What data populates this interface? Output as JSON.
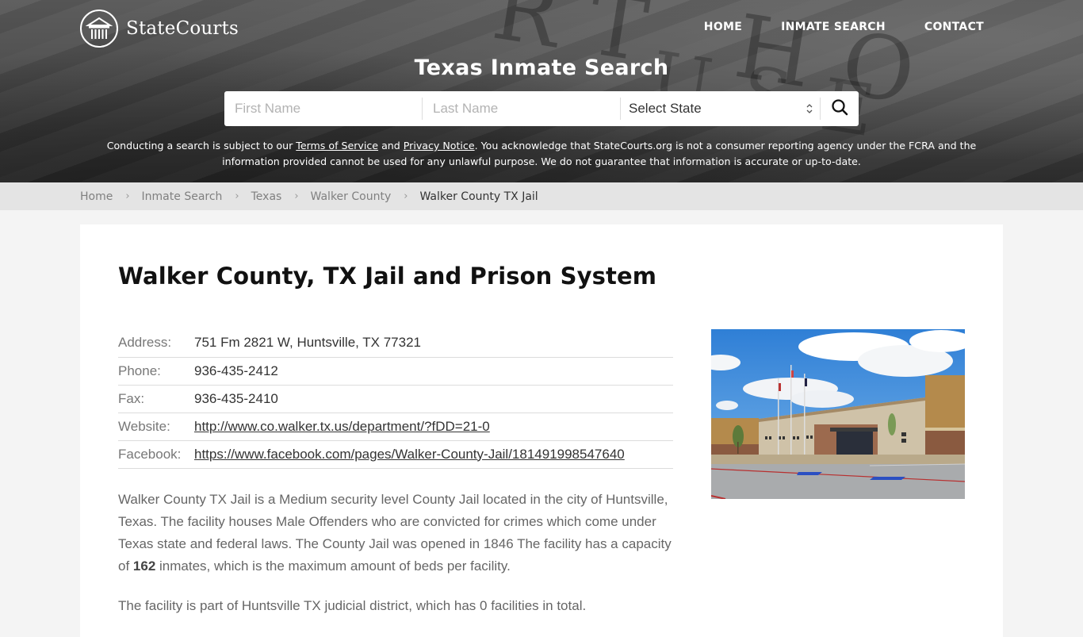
{
  "brand": {
    "name": "StateCourts"
  },
  "nav": {
    "items": [
      {
        "label": "HOME"
      },
      {
        "label": "INMATE SEARCH"
      },
      {
        "label": "CONTACT"
      }
    ]
  },
  "hero": {
    "title": "Texas Inmate Search",
    "watermark_line1": "RT HO",
    "watermark_line2": "USE"
  },
  "search": {
    "first_name_placeholder": "First Name",
    "last_name_placeholder": "Last Name",
    "state_selected": "Select State",
    "search_icon": "search-icon"
  },
  "disclaimer": {
    "part1": "Conducting a search is subject to our ",
    "terms_link": "Terms of Service",
    "part2": " and ",
    "privacy_link": "Privacy Notice",
    "part3": ". You acknowledge that StateCourts.org is not a consumer reporting agency under the FCRA and the information provided cannot be used for any unlawful purpose. We do not guarantee that information is accurate or up-to-date."
  },
  "breadcrumb": {
    "items": [
      {
        "label": "Home"
      },
      {
        "label": "Inmate Search"
      },
      {
        "label": "Texas"
      },
      {
        "label": "Walker County"
      }
    ],
    "current": "Walker County TX Jail",
    "separator": "›"
  },
  "page": {
    "title": "Walker County, TX Jail and Prison System",
    "info": [
      {
        "label": "Address:",
        "value": "751 Fm 2821 W, Huntsville, TX 77321"
      },
      {
        "label": "Phone:",
        "value": "936-435-2412"
      },
      {
        "label": "Fax:",
        "value": "936-435-2410"
      },
      {
        "label": "Website:",
        "value": "http://www.co.walker.tx.us/department/?fDD=21-0"
      },
      {
        "label": "Facebook:",
        "value": "https://www.facebook.com/pages/Walker-County-Jail/181491998547640"
      }
    ],
    "description": {
      "p1_before": "Walker County TX Jail is a Medium security level County Jail located in the city of Huntsville, Texas. The facility houses Male Offenders who are convicted for crimes which come under Texas state and federal laws. The County Jail was opened in 1846 The facility has a capacity of ",
      "capacity": "162",
      "p1_after": " inmates, which is the maximum amount of beds per facility.",
      "p2": "The facility is part of Huntsville TX judicial district, which has 0 facilities in total."
    }
  },
  "colors": {
    "breadcrumb_bg": "#e4e4e4",
    "page_bg": "#f4f4f4",
    "card_bg": "#ffffff",
    "title_text": "#111111"
  }
}
